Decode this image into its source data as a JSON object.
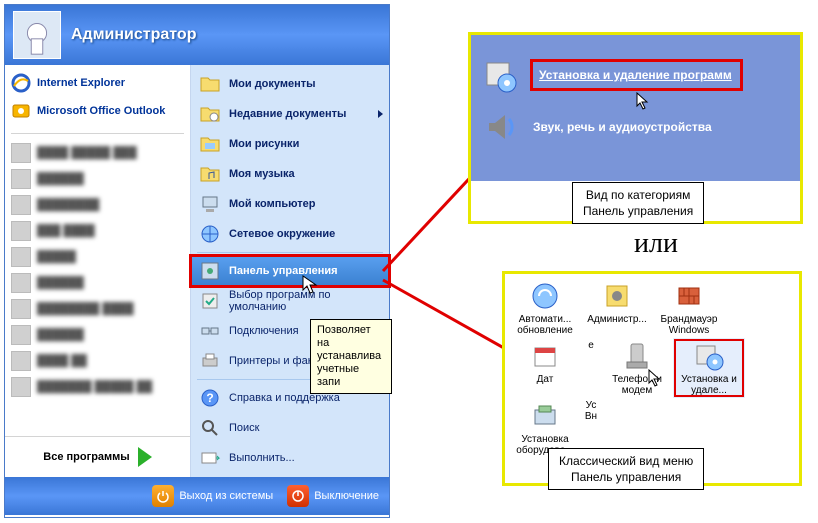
{
  "header": {
    "user": "Администратор"
  },
  "pinned": {
    "ie": "Internet Explorer",
    "outlook": "Microsoft Office Outlook"
  },
  "mru": [
    "████ █████ ███",
    "██████",
    "████████",
    "███ ████",
    "█████",
    "██████",
    "████████ ████",
    "██████",
    "████ ██",
    "███████ █████ ██"
  ],
  "allprograms": "Все программы",
  "right": {
    "mydocs": "Мои документы",
    "recent": "Недавние документы",
    "mypics": "Мои рисунки",
    "mymusic": "Моя музыка",
    "mycomputer": "Мой компьютер",
    "network": "Сетевое окружение",
    "cpanel": "Панель управления",
    "defprog": "Выбор программ по умолчанию",
    "connections": "Подключения",
    "printers": "Принтеры и факсы",
    "help": "Справка и поддержка",
    "search": "Поиск",
    "run": "Выполнить..."
  },
  "tooltip": "Позволяет на устанавлива учетные запи",
  "footer": {
    "logoff": "Выход из системы",
    "shutdown": "Выключение"
  },
  "category_view": {
    "addremove": "Установка и удаление программ",
    "sound": "Звук, речь и аудиоустройства",
    "caption1": "Вид по категориям",
    "caption2": "Панель управления"
  },
  "or": "или",
  "classic_view": {
    "items": [
      {
        "label": "Автомати... обновление"
      },
      {
        "label": "Администр..."
      },
      {
        "label": "Брандмауэр Windows"
      },
      {
        "label": "Дат"
      },
      {
        "label": "е"
      },
      {
        "label": "Телефон и модем"
      },
      {
        "label": "Установка и удале..."
      },
      {
        "label": "Установка оборудова..."
      },
      {
        "label": "Ус Вн"
      }
    ],
    "caption1": "Классический вид меню",
    "caption2": "Панель управления"
  }
}
